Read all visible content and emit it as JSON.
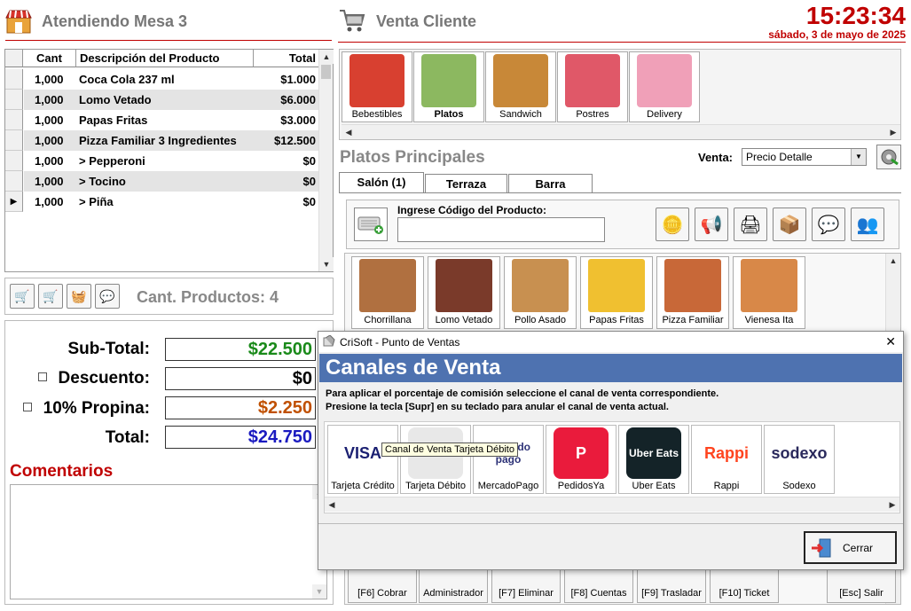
{
  "left_header": {
    "title": "Atendiendo Mesa 3",
    "icon": "store-icon"
  },
  "center_header": {
    "title": "Venta Cliente",
    "icon": "shopping-cart-icon"
  },
  "clock": {
    "time": "15:23:34",
    "date": "sábado, 3 de mayo de 2025"
  },
  "order_grid": {
    "headers": {
      "qty": "Cant",
      "desc": "Descripción del Producto",
      "total": "Total"
    },
    "rows": [
      {
        "qty": "1,000",
        "desc": "Coca Cola 237 ml",
        "total": "$1.000"
      },
      {
        "qty": "1,000",
        "desc": "Lomo Vetado",
        "total": "$6.000"
      },
      {
        "qty": "1,000",
        "desc": "Papas Fritas",
        "total": "$3.000"
      },
      {
        "qty": "1,000",
        "desc": "Pizza Familiar 3 Ingredientes",
        "total": "$12.500"
      },
      {
        "qty": "1,000",
        "desc": "> Pepperoni",
        "total": "$0"
      },
      {
        "qty": "1,000",
        "desc": "> Tocino",
        "total": "$0"
      },
      {
        "qty": "1,000",
        "desc": "> Piña",
        "total": "$0"
      }
    ]
  },
  "product_count": "Cant. Productos: 4",
  "totals": {
    "subtotal_label": "Sub-Total:",
    "subtotal": "$22.500",
    "discount_label": "Descuento:",
    "discount": "$0",
    "tip_label": "10% Propina:",
    "tip": "$2.250",
    "total_label": "Total:",
    "total": "$24.750",
    "subtotal_color": "#1a8a1a",
    "tip_color": "#c05000",
    "total_color": "#1a1ac0"
  },
  "comments_label": "Comentarios",
  "categories": [
    {
      "label": "Bebestibles",
      "icon": "drinks-icon",
      "color": "#d84030",
      "selected": false
    },
    {
      "label": "Platos",
      "icon": "plate-icon",
      "color": "#8cb860",
      "selected": true
    },
    {
      "label": "Sandwich",
      "icon": "sandwich-icon",
      "color": "#c88838",
      "selected": false
    },
    {
      "label": "Postres",
      "icon": "dessert-icon",
      "color": "#e05868",
      "selected": false
    },
    {
      "label": "Delivery",
      "icon": "delivery-icon",
      "color": "#f0a0b8",
      "selected": false
    }
  ],
  "section_title": "Platos Principales",
  "sale": {
    "label": "Venta:",
    "selected": "Precio Detalle"
  },
  "tabs": [
    "Salón (1)",
    "Terraza",
    "Barra"
  ],
  "product_code": {
    "label": "Ingrese Código del Producto:",
    "value": ""
  },
  "products": [
    {
      "label": "Chorrillana",
      "color": "#b07040"
    },
    {
      "label": "Lomo Vetado",
      "color": "#7a3a2a"
    },
    {
      "label": "Pollo Asado",
      "color": "#c89050"
    },
    {
      "label": "Papas Fritas",
      "color": "#f0c030"
    },
    {
      "label": "Pizza Familiar",
      "color": "#c86838"
    },
    {
      "label": "Vienesa Ita",
      "color": "#d88848"
    }
  ],
  "function_keys": [
    "[F6] Cobrar",
    "Administrador",
    "[F7] Eliminar",
    "[F8] Cuentas",
    "[F9] Trasladar",
    "[F10] Ticket",
    "[Esc] Salir"
  ],
  "dialog": {
    "window_title": "CriSoft - Punto de Ventas",
    "heading": "Canales de Venta",
    "instruction_1": "Para aplicar el porcentaje de comisión seleccione el canal de venta correspondiente.",
    "instruction_2": "Presione la tecla [Supr] en su teclado para anular el canal de venta actual.",
    "channels": [
      {
        "label": "Tarjeta Crédito",
        "logo_text": "VISA",
        "bg": "#ffffff",
        "fg": "#1a1f71"
      },
      {
        "label": "Tarjeta Débito",
        "logo_text": "",
        "bg": "#e8e8e8",
        "fg": "#444444"
      },
      {
        "label": "MercadoPago",
        "logo_text": "mercado pago",
        "bg": "#ffffff",
        "fg": "#2d3277"
      },
      {
        "label": "PedidosYa",
        "logo_text": "P",
        "bg": "#ea1b3c",
        "fg": "#ffffff"
      },
      {
        "label": "Uber Eats",
        "logo_text": "Uber Eats",
        "bg": "#142328",
        "fg": "#ffffff"
      },
      {
        "label": "Rappi",
        "logo_text": "Rappi",
        "bg": "#ffffff",
        "fg": "#ff441f"
      },
      {
        "label": "Sodexo",
        "logo_text": "sodexo",
        "bg": "#ffffff",
        "fg": "#2a295c"
      }
    ],
    "tooltip": "Canal de Venta Tarjeta Débito",
    "close_label": "Cerrar",
    "close_x": "✕"
  }
}
